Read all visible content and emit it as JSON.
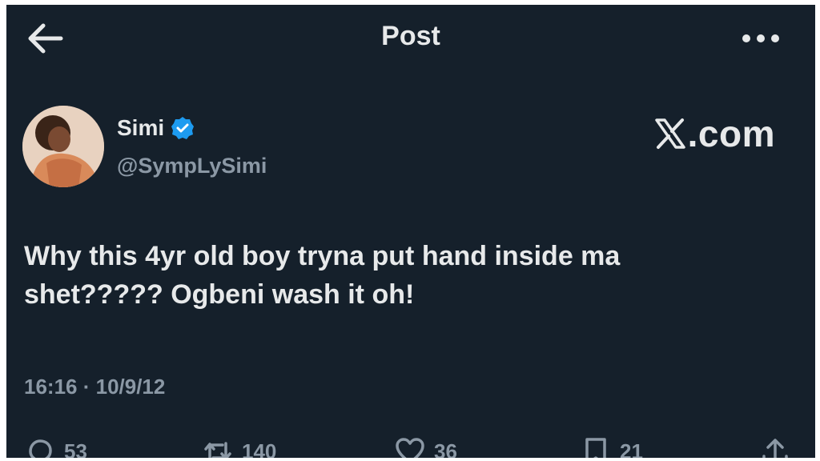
{
  "header": {
    "title": "Post",
    "back_icon": "arrow-left-icon",
    "more_icon": "more-dots-icon"
  },
  "author": {
    "display_name": "Simi",
    "handle": "@SympLySimi",
    "verified": true,
    "verified_color": "#1d9bf0"
  },
  "watermark": {
    "text": ".com",
    "icon": "x-logo-icon"
  },
  "post": {
    "line1": "Why this 4yr old boy tryna put hand inside ma",
    "line2": "shet????? Ogbeni wash it oh!",
    "timestamp": "16:16 · 10/9/12"
  },
  "actions": {
    "replies": "53",
    "reposts": "140",
    "likes": "36",
    "bookmarks": "21"
  },
  "colors": {
    "background": "#15202b",
    "text": "#e7e9ea",
    "muted": "#8b98a5"
  }
}
